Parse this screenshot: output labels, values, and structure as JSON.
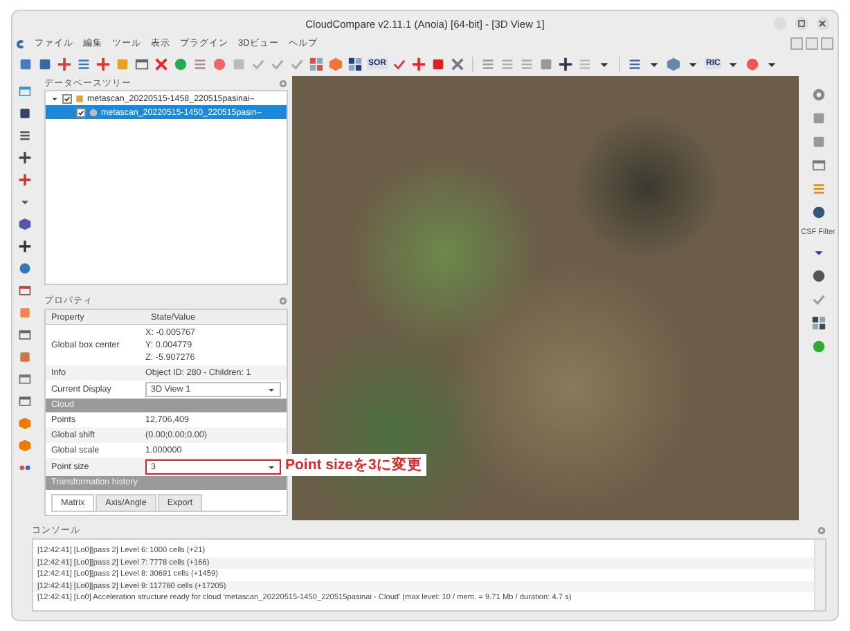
{
  "window": {
    "title": "CloudCompare v2.11.1 (Anoia) [64-bit] - [3D View 1]"
  },
  "menu": [
    "ファイル",
    "編集",
    "ツール",
    "表示",
    "プラグイン",
    "3Dビュー",
    "ヘルプ"
  ],
  "toolbar_labels": [
    "SOR",
    "RIC"
  ],
  "db_tree": {
    "title": "データベースツリー",
    "items": [
      {
        "label": "metascan_20220515-1458_220515pasinai–",
        "checked": true,
        "expanded": true,
        "selected": false,
        "children": [
          {
            "label": "metascan_20220515-1450_220515pasin–",
            "checked": true,
            "selected": true
          }
        ]
      }
    ]
  },
  "properties": {
    "title": "プロパティ",
    "columns": [
      "Property",
      "State/Value"
    ],
    "rows": [
      {
        "kind": "text",
        "name": "Global box center",
        "value": [
          "X: -0.005767",
          "Y: 0.004779",
          "Z: -5.907276"
        ]
      },
      {
        "kind": "text",
        "name": "Info",
        "value": [
          "Object ID: 280 - Children: 1"
        ]
      },
      {
        "kind": "combo",
        "name": "Current Display",
        "value": [
          "3D View 1"
        ],
        "highlighted": false
      },
      {
        "kind": "section",
        "name": "Cloud"
      },
      {
        "kind": "text",
        "name": "Points",
        "value": [
          "12,706,409"
        ]
      },
      {
        "kind": "text",
        "name": "Global shift",
        "value": [
          "(0.00;0.00;0.00)"
        ]
      },
      {
        "kind": "text",
        "name": "Global scale",
        "value": [
          "1.000000"
        ]
      },
      {
        "kind": "combo",
        "name": "Point size",
        "value": [
          "3"
        ],
        "highlighted": true
      },
      {
        "kind": "section",
        "name": "Transformation history"
      }
    ],
    "tabs": [
      {
        "label": "Matrix",
        "selected": true
      },
      {
        "label": "Axis/Angle",
        "selected": false
      },
      {
        "label": "Export",
        "selected": false
      }
    ]
  },
  "annotation": "Point sizeを3に変更",
  "right_toolbar_label": "CSF Filter",
  "console": {
    "title": "コンソール",
    "lines": [
      {
        "text": "[12:42:41] [Lo0][pass 2] Level 6: 1000 cells (+21)",
        "selected": false
      },
      {
        "text": "[12:42:41] [Lo0][pass 2] Level 7: 7778 cells (+166)",
        "selected": false
      },
      {
        "text": "[12:42:41] [Lo0][pass 2] Level 8: 30691 cells (+1459)",
        "selected": false
      },
      {
        "text": "[12:42:41] [Lo0][pass 2] Level 9: 117780 cells (+17205)",
        "selected": false
      },
      {
        "text": "[12:42:41] [Lo0] Acceleration structure ready for cloud 'metascan_20220515-1450_220515pasinai - Cloud' (max level: 10 / mem. = 9.71 Mb / duration: 4.7 s)",
        "selected": false
      }
    ]
  }
}
